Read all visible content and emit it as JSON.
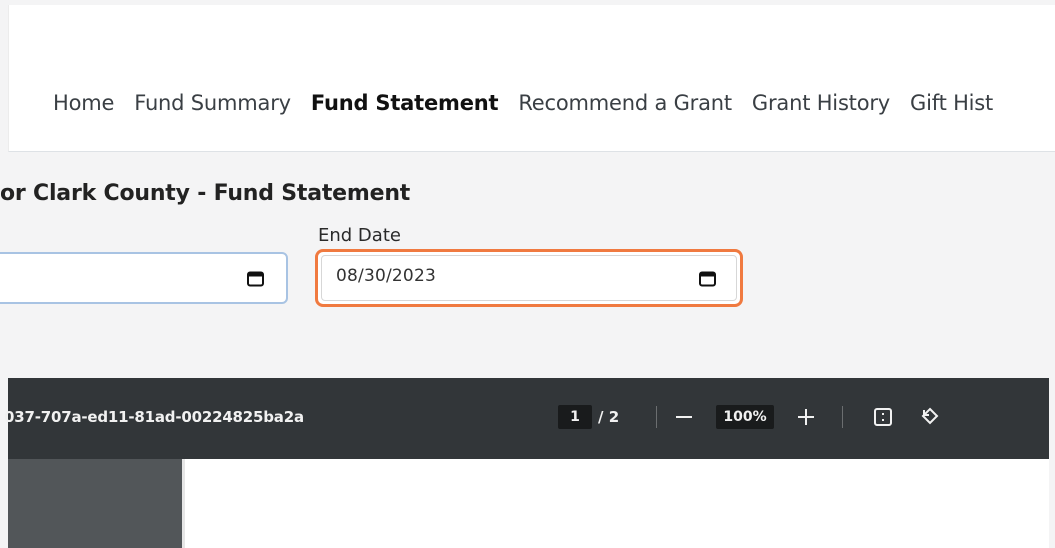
{
  "nav": {
    "items": [
      {
        "label": "Home"
      },
      {
        "label": "Fund Summary"
      },
      {
        "label": "Fund Statement"
      },
      {
        "label": "Recommend a Grant"
      },
      {
        "label": "Grant History"
      },
      {
        "label": "Gift Hist"
      }
    ]
  },
  "statement": {
    "title": "or Clark County - Fund Statement",
    "end_date_label": "End Date",
    "end_date_value": "08/30/2023"
  },
  "pdf": {
    "filename": "037-707a-ed11-81ad-00224825ba2a",
    "page_current": "1",
    "page_total": "/  2",
    "zoom": "100%"
  },
  "colors": {
    "focus_border": "#f07a40",
    "toolbar_bg": "#323639",
    "start_field_border": "#a8c3e3"
  },
  "icons": [
    "calendar-icon",
    "zoom-out-icon",
    "zoom-in-icon",
    "fit-page-icon",
    "rotate-icon"
  ]
}
